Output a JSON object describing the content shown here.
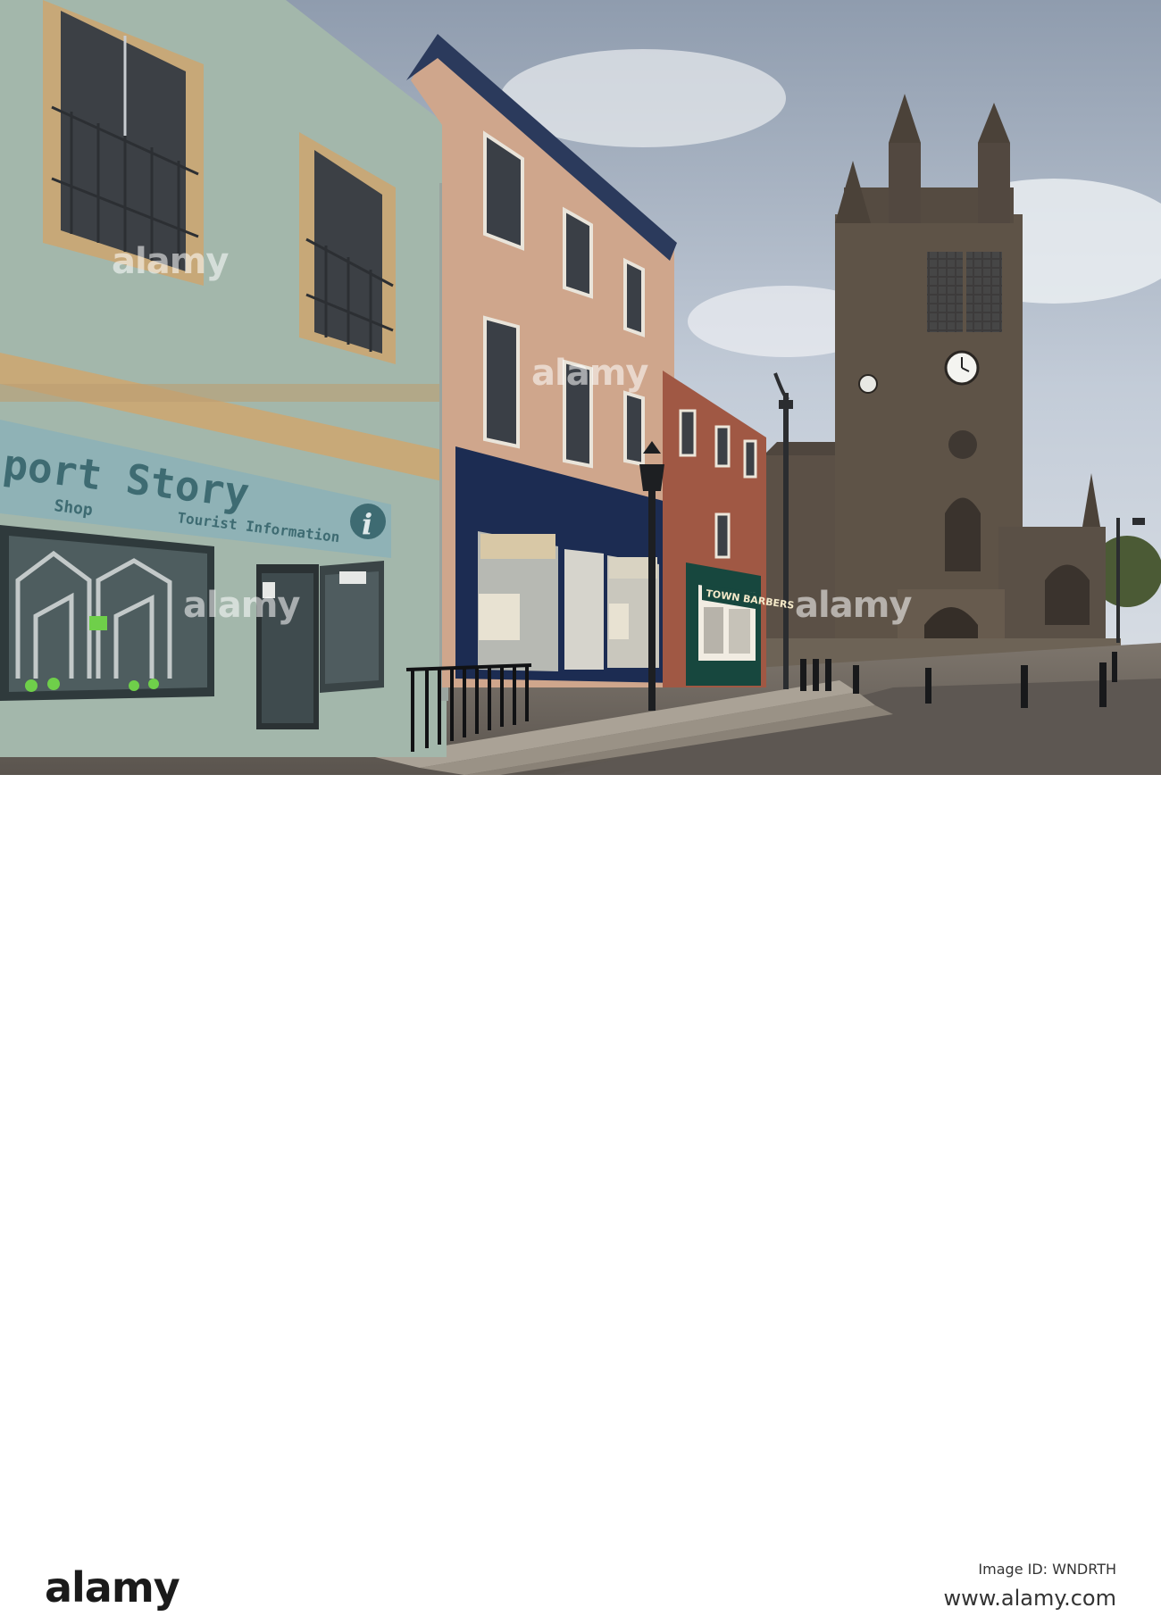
{
  "watermark": {
    "brand": "alamy",
    "brand_dot": "a"
  },
  "footer": {
    "image_id_label": "Image ID: WNDRTH",
    "site_url": "www.alamy.com"
  },
  "signs": {
    "tourist_sign_main": "port Story",
    "tourist_sign_shop": "Shop",
    "tourist_sign_info": "Tourist Information",
    "info_icon_letter": "i",
    "barbers_sign": "TOWN BARBERS"
  },
  "colors": {
    "sky": "#c8d0da",
    "green_building": "#a3b7ab",
    "sandstone_building": "#cfa68c",
    "brick_building": "#a05844",
    "church_stone": "#5e5347",
    "shopfront_navy": "#1c2c52",
    "pavement": "#8b8176"
  }
}
